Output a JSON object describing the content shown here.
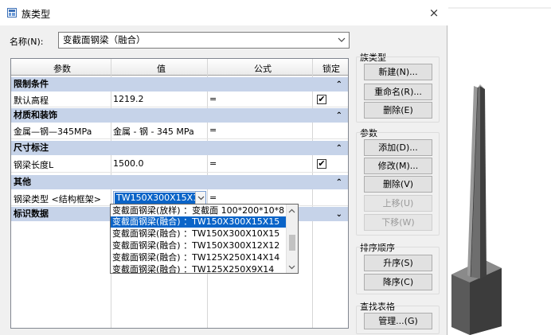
{
  "window": {
    "title": "族类型",
    "close": "×"
  },
  "name_field": {
    "label": "名称(N):",
    "value": "变截面钢梁（融合）"
  },
  "grid": {
    "headers": {
      "param": "参数",
      "value": "值",
      "formula": "公式",
      "lock": "锁定"
    },
    "groups": {
      "constraints": "限制条件",
      "materials": "材质和装饰",
      "dimensions": "尺寸标注",
      "other": "其他",
      "identity": "标识数据"
    },
    "rows": {
      "default_elevation": {
        "name": "默认高程",
        "value": "1219.2",
        "formula": "="
      },
      "metal": {
        "name": "金属—钢—345MPa",
        "value": "金属 - 钢 - 345 MPa",
        "formula": "="
      },
      "beam_length": {
        "name": "钢梁长度L",
        "value": "1500.0",
        "formula": "="
      },
      "beam_type": {
        "name": "钢梁类型 <结构框架>",
        "value": "TW150X300X15X15",
        "formula": "="
      }
    },
    "lock_check": "✔"
  },
  "dropdown": {
    "items": [
      "变截面钢梁(放样) ：变截面 100*200*10*8",
      "变截面钢梁(融合) ：TW150X300X15X15",
      "变截面钢梁(融合) ：TW150X300X10X15",
      "变截面钢梁(融合) ：TW150X300X12X12",
      "变截面钢梁(融合) ：TW125X250X14X14",
      "变截面钢梁(融合) ：TW125X250X9X14"
    ],
    "selected_index": 1
  },
  "side": {
    "family_types": {
      "label": "族类型",
      "new": "新建(N)...",
      "rename": "重命名(R)...",
      "delete": "删除(E)"
    },
    "parameters": {
      "label": "参数",
      "add": "添加(D)...",
      "modify": "修改(M)...",
      "delete": "删除(V)",
      "move_up": "上移(U)",
      "move_down": "下移(W)"
    },
    "sort": {
      "label": "排序顺序",
      "asc": "升序(S)",
      "desc": "降序(C)"
    },
    "lookup": {
      "label": "查找表格",
      "manage": "管理...(G)"
    }
  },
  "colors": {
    "group_header": "#c6d3e9",
    "selection": "#0a64c8",
    "dialog_bg": "#f0f0f0"
  }
}
